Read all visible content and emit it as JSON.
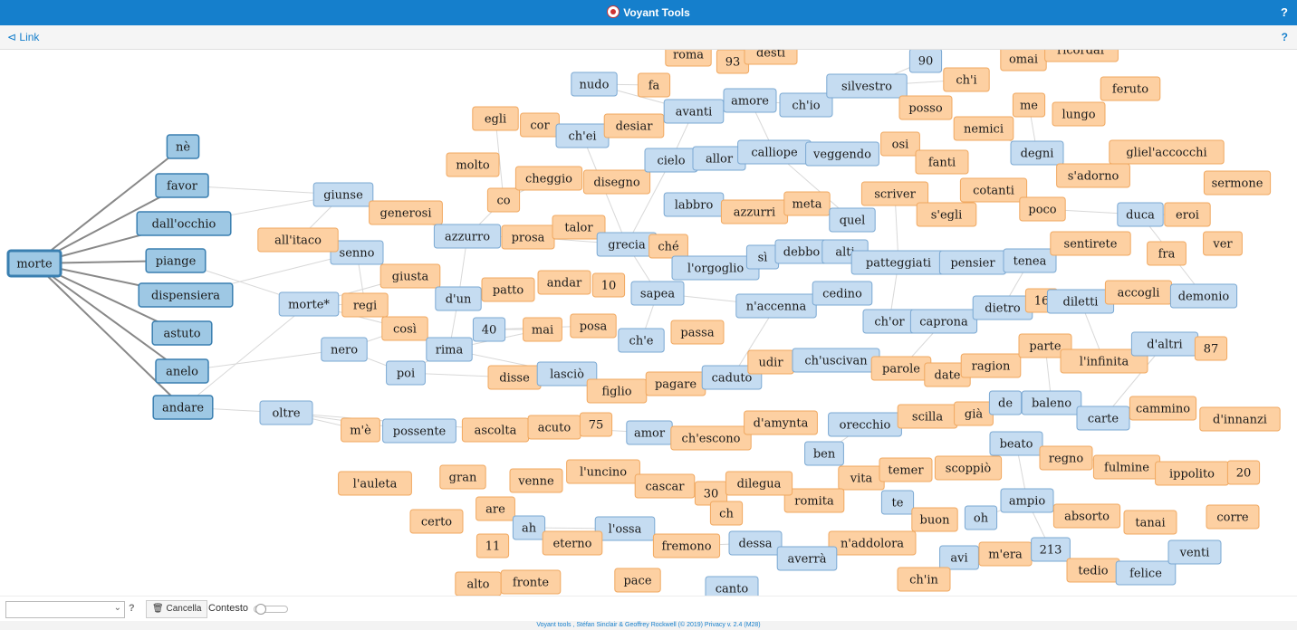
{
  "app": {
    "title": "Voyant Tools",
    "help": "?"
  },
  "toolbar": {
    "link_label": "Link",
    "help": "?"
  },
  "graph": {
    "colors": {
      "corpus_fill": "#9ec8e4",
      "corpus_stroke": "#3a7fb0",
      "blue_fill": "#c5dcf1",
      "blue_stroke": "#7aa8d2",
      "orange_fill": "#fdd0a2",
      "orange_stroke": "#f0a860",
      "edge_main": "#888888",
      "edge_light": "#d8d8d8"
    },
    "nodes": [
      {
        "id": "morte",
        "label": "morte",
        "type": "root"
      },
      {
        "id": "ne",
        "label": "nè",
        "type": "corpus"
      },
      {
        "id": "favor",
        "label": "favor",
        "type": "corpus"
      },
      {
        "id": "dallocchio",
        "label": "dall'occhio",
        "type": "corpus"
      },
      {
        "id": "piange",
        "label": "piange",
        "type": "corpus"
      },
      {
        "id": "dispensiera",
        "label": "dispensiera",
        "type": "corpus"
      },
      {
        "id": "astuto",
        "label": "astuto",
        "type": "corpus"
      },
      {
        "id": "anelo",
        "label": "anelo",
        "type": "corpus"
      },
      {
        "id": "andare",
        "label": "andare",
        "type": "corpus"
      },
      {
        "id": "giunse",
        "label": "giunse",
        "type": "blue"
      },
      {
        "id": "senno",
        "label": "senno",
        "type": "blue"
      },
      {
        "id": "morte2",
        "label": "morte*",
        "type": "blue"
      },
      {
        "id": "nero",
        "label": "nero",
        "type": "blue"
      },
      {
        "id": "oltre",
        "label": "oltre",
        "type": "blue"
      },
      {
        "id": "allitaco",
        "label": "all'itaco",
        "type": "orange"
      },
      {
        "id": "generosi",
        "label": "generosi",
        "type": "orange"
      },
      {
        "id": "giusta",
        "label": "giusta",
        "type": "orange"
      },
      {
        "id": "regi",
        "label": "regi",
        "type": "orange"
      },
      {
        "id": "cosi",
        "label": "così",
        "type": "orange"
      },
      {
        "id": "poi",
        "label": "poi",
        "type": "blue"
      },
      {
        "id": "rima",
        "label": "rima",
        "type": "blue"
      },
      {
        "id": "dun",
        "label": "d'un",
        "type": "blue"
      },
      {
        "id": "n40",
        "label": "40",
        "type": "blue"
      },
      {
        "id": "azzurro",
        "label": "azzurro",
        "type": "blue"
      },
      {
        "id": "molto",
        "label": "molto",
        "type": "orange"
      },
      {
        "id": "co",
        "label": "co",
        "type": "orange"
      },
      {
        "id": "egli",
        "label": "egli",
        "type": "orange"
      },
      {
        "id": "cor",
        "label": "cor",
        "type": "orange"
      },
      {
        "id": "chei",
        "label": "ch'ei",
        "type": "blue"
      },
      {
        "id": "cheggio",
        "label": "cheggio",
        "type": "orange"
      },
      {
        "id": "prosa",
        "label": "prosa",
        "type": "orange"
      },
      {
        "id": "talor",
        "label": "talor",
        "type": "orange"
      },
      {
        "id": "patto",
        "label": "patto",
        "type": "orange"
      },
      {
        "id": "andar",
        "label": "andar",
        "type": "orange"
      },
      {
        "id": "n10",
        "label": "10",
        "type": "orange"
      },
      {
        "id": "mai",
        "label": "mai",
        "type": "orange"
      },
      {
        "id": "posa",
        "label": "posa",
        "type": "orange"
      },
      {
        "id": "disse",
        "label": "disse",
        "type": "orange"
      },
      {
        "id": "lascio",
        "label": "lasciò",
        "type": "blue"
      },
      {
        "id": "figlio",
        "label": "figlio",
        "type": "orange"
      },
      {
        "id": "nudo",
        "label": "nudo",
        "type": "blue"
      },
      {
        "id": "fa",
        "label": "fa",
        "type": "orange"
      },
      {
        "id": "desiar",
        "label": "desiar",
        "type": "orange"
      },
      {
        "id": "disegno",
        "label": "disegno",
        "type": "orange"
      },
      {
        "id": "grecia",
        "label": "grecia",
        "type": "blue"
      },
      {
        "id": "che",
        "label": "ché",
        "type": "orange"
      },
      {
        "id": "sapea",
        "label": "sapea",
        "type": "blue"
      },
      {
        "id": "che2",
        "label": "ch'e",
        "type": "blue"
      },
      {
        "id": "passa",
        "label": "passa",
        "type": "orange"
      },
      {
        "id": "pagare",
        "label": "pagare",
        "type": "orange"
      },
      {
        "id": "caduto",
        "label": "caduto",
        "type": "blue"
      },
      {
        "id": "roma",
        "label": "roma",
        "type": "orange"
      },
      {
        "id": "n93",
        "label": "93",
        "type": "orange"
      },
      {
        "id": "desti",
        "label": "desti",
        "type": "orange"
      },
      {
        "id": "avanti",
        "label": "avanti",
        "type": "blue"
      },
      {
        "id": "amore",
        "label": "amore",
        "type": "blue"
      },
      {
        "id": "chio",
        "label": "ch'io",
        "type": "blue"
      },
      {
        "id": "cielo",
        "label": "cielo",
        "type": "blue"
      },
      {
        "id": "allor",
        "label": "allor",
        "type": "blue"
      },
      {
        "id": "calliope",
        "label": "calliope",
        "type": "blue"
      },
      {
        "id": "veggendo",
        "label": "veggendo",
        "type": "blue"
      },
      {
        "id": "labbro",
        "label": "labbro",
        "type": "blue"
      },
      {
        "id": "azzurri",
        "label": "azzurri",
        "type": "orange"
      },
      {
        "id": "meta",
        "label": "meta",
        "type": "orange"
      },
      {
        "id": "quel",
        "label": "quel",
        "type": "blue"
      },
      {
        "id": "lorgoglio",
        "label": "l'orgoglio",
        "type": "blue"
      },
      {
        "id": "si",
        "label": "sì",
        "type": "blue"
      },
      {
        "id": "debbo",
        "label": "debbo",
        "type": "blue"
      },
      {
        "id": "alti",
        "label": "alti",
        "type": "blue"
      },
      {
        "id": "naccenna",
        "label": "n'accenna",
        "type": "blue"
      },
      {
        "id": "cedino",
        "label": "cedino",
        "type": "blue"
      },
      {
        "id": "udir",
        "label": "udir",
        "type": "orange"
      },
      {
        "id": "chuscivan",
        "label": "ch'uscivan",
        "type": "blue"
      },
      {
        "id": "silvestro",
        "label": "silvestro",
        "type": "blue"
      },
      {
        "id": "n90",
        "label": "90",
        "type": "blue"
      },
      {
        "id": "posso",
        "label": "posso",
        "type": "orange"
      },
      {
        "id": "chi",
        "label": "ch'i",
        "type": "orange"
      },
      {
        "id": "osi",
        "label": "osi",
        "type": "orange"
      },
      {
        "id": "fanti",
        "label": "fanti",
        "type": "orange"
      },
      {
        "id": "scriver",
        "label": "scriver",
        "type": "orange"
      },
      {
        "id": "segli",
        "label": "s'egli",
        "type": "orange"
      },
      {
        "id": "cotanti",
        "label": "cotanti",
        "type": "orange"
      },
      {
        "id": "patteggiati",
        "label": "patteggiati",
        "type": "blue"
      },
      {
        "id": "pensier",
        "label": "pensier",
        "type": "blue"
      },
      {
        "id": "tenea",
        "label": "tenea",
        "type": "blue"
      },
      {
        "id": "chor",
        "label": "ch'or",
        "type": "blue"
      },
      {
        "id": "caprona",
        "label": "caprona",
        "type": "blue"
      },
      {
        "id": "dietro",
        "label": "dietro",
        "type": "blue"
      },
      {
        "id": "parole",
        "label": "parole",
        "type": "orange"
      },
      {
        "id": "date",
        "label": "date",
        "type": "orange"
      },
      {
        "id": "ragion",
        "label": "ragion",
        "type": "orange"
      },
      {
        "id": "orecchio",
        "label": "orecchio",
        "type": "blue"
      },
      {
        "id": "scilla",
        "label": "scilla",
        "type": "orange"
      },
      {
        "id": "gia",
        "label": "già",
        "type": "orange"
      },
      {
        "id": "ben",
        "label": "ben",
        "type": "blue"
      },
      {
        "id": "vita",
        "label": "vita",
        "type": "orange"
      },
      {
        "id": "temer",
        "label": "temer",
        "type": "orange"
      },
      {
        "id": "scoppio",
        "label": "scoppiò",
        "type": "orange"
      },
      {
        "id": "romita",
        "label": "romita",
        "type": "orange"
      },
      {
        "id": "te",
        "label": "te",
        "type": "blue"
      },
      {
        "id": "buon",
        "label": "buon",
        "type": "orange"
      },
      {
        "id": "oh",
        "label": "oh",
        "type": "blue"
      },
      {
        "id": "naddolora",
        "label": "n'addolora",
        "type": "orange"
      },
      {
        "id": "avi",
        "label": "avi",
        "type": "blue"
      },
      {
        "id": "mera",
        "label": "m'era",
        "type": "orange"
      },
      {
        "id": "n213",
        "label": "213",
        "type": "blue"
      },
      {
        "id": "chin",
        "label": "ch'in",
        "type": "orange"
      },
      {
        "id": "omai",
        "label": "omai",
        "type": "orange"
      },
      {
        "id": "ricordar",
        "label": "ricordar",
        "type": "orange"
      },
      {
        "id": "me",
        "label": "me",
        "type": "orange"
      },
      {
        "id": "nemici",
        "label": "nemici",
        "type": "orange"
      },
      {
        "id": "feruto",
        "label": "feruto",
        "type": "orange"
      },
      {
        "id": "lungo",
        "label": "lungo",
        "type": "orange"
      },
      {
        "id": "degni",
        "label": "degni",
        "type": "blue"
      },
      {
        "id": "glielaccocchi",
        "label": "gliel'accocchi",
        "type": "orange"
      },
      {
        "id": "sadorno",
        "label": "s'adorno",
        "type": "orange"
      },
      {
        "id": "sermone",
        "label": "sermone",
        "type": "orange"
      },
      {
        "id": "poco",
        "label": "poco",
        "type": "orange"
      },
      {
        "id": "duca",
        "label": "duca",
        "type": "blue"
      },
      {
        "id": "eroi",
        "label": "eroi",
        "type": "orange"
      },
      {
        "id": "sentirete",
        "label": "sentirete",
        "type": "orange"
      },
      {
        "id": "fra",
        "label": "fra",
        "type": "orange"
      },
      {
        "id": "ver",
        "label": "ver",
        "type": "orange"
      },
      {
        "id": "n16",
        "label": "16",
        "type": "orange"
      },
      {
        "id": "diletti",
        "label": "diletti",
        "type": "blue"
      },
      {
        "id": "accogli",
        "label": "accogli",
        "type": "orange"
      },
      {
        "id": "demonio",
        "label": "demonio",
        "type": "blue"
      },
      {
        "id": "parte",
        "label": "parte",
        "type": "orange"
      },
      {
        "id": "linfinita",
        "label": "l'infinita",
        "type": "orange"
      },
      {
        "id": "daltri",
        "label": "d'altri",
        "type": "blue"
      },
      {
        "id": "n87",
        "label": "87",
        "type": "orange"
      },
      {
        "id": "de",
        "label": "de",
        "type": "blue"
      },
      {
        "id": "baleno",
        "label": "baleno",
        "type": "blue"
      },
      {
        "id": "carte",
        "label": "carte",
        "type": "blue"
      },
      {
        "id": "cammino",
        "label": "cammino",
        "type": "orange"
      },
      {
        "id": "dinnanzi",
        "label": "d'innanzi",
        "type": "orange"
      },
      {
        "id": "beato",
        "label": "beato",
        "type": "blue"
      },
      {
        "id": "regno",
        "label": "regno",
        "type": "orange"
      },
      {
        "id": "fulmine",
        "label": "fulmine",
        "type": "orange"
      },
      {
        "id": "ippolito",
        "label": "ippolito",
        "type": "orange"
      },
      {
        "id": "n20",
        "label": "20",
        "type": "orange"
      },
      {
        "id": "ampio",
        "label": "ampio",
        "type": "blue"
      },
      {
        "id": "absorto",
        "label": "absorto",
        "type": "orange"
      },
      {
        "id": "tanai",
        "label": "tanai",
        "type": "orange"
      },
      {
        "id": "corre",
        "label": "corre",
        "type": "orange"
      },
      {
        "id": "tedio",
        "label": "tedio",
        "type": "orange"
      },
      {
        "id": "felice",
        "label": "felice",
        "type": "blue"
      },
      {
        "id": "venti",
        "label": "venti",
        "type": "blue"
      },
      {
        "id": "mee",
        "label": "m'è",
        "type": "orange"
      },
      {
        "id": "possente",
        "label": "possente",
        "type": "blue"
      },
      {
        "id": "ascolta",
        "label": "ascolta",
        "type": "orange"
      },
      {
        "id": "acuto",
        "label": "acuto",
        "type": "orange"
      },
      {
        "id": "n75",
        "label": "75",
        "type": "orange"
      },
      {
        "id": "amor",
        "label": "amor",
        "type": "blue"
      },
      {
        "id": "chescono",
        "label": "ch'escono",
        "type": "orange"
      },
      {
        "id": "damynta",
        "label": "d'amynta",
        "type": "orange"
      },
      {
        "id": "lauleta",
        "label": "l'auleta",
        "type": "orange"
      },
      {
        "id": "gran",
        "label": "gran",
        "type": "orange"
      },
      {
        "id": "venne",
        "label": "venne",
        "type": "orange"
      },
      {
        "id": "luncino",
        "label": "l'uncino",
        "type": "orange"
      },
      {
        "id": "cascar",
        "label": "cascar",
        "type": "orange"
      },
      {
        "id": "n30",
        "label": "30",
        "type": "orange"
      },
      {
        "id": "dilegua",
        "label": "dilegua",
        "type": "orange"
      },
      {
        "id": "ch",
        "label": "ch",
        "type": "orange"
      },
      {
        "id": "certo",
        "label": "certo",
        "type": "orange"
      },
      {
        "id": "are",
        "label": "are",
        "type": "orange"
      },
      {
        "id": "ah",
        "label": "ah",
        "type": "blue"
      },
      {
        "id": "lossa",
        "label": "l'ossa",
        "type": "blue"
      },
      {
        "id": "eterno",
        "label": "eterno",
        "type": "orange"
      },
      {
        "id": "fremono",
        "label": "fremono",
        "type": "orange"
      },
      {
        "id": "dessa",
        "label": "dessa",
        "type": "blue"
      },
      {
        "id": "averra",
        "label": "averrà",
        "type": "blue"
      },
      {
        "id": "n11",
        "label": "11",
        "type": "orange"
      },
      {
        "id": "alto",
        "label": "alto",
        "type": "orange"
      },
      {
        "id": "fronte",
        "label": "fronte",
        "type": "orange"
      },
      {
        "id": "pace",
        "label": "pace",
        "type": "orange"
      },
      {
        "id": "canto",
        "label": "canto",
        "type": "blue"
      }
    ]
  },
  "bottom": {
    "clear_label": "Cancella",
    "context_label": "Contesto",
    "help": "?"
  },
  "footer": {
    "text": "Voyant tools , Stéfan Sinclair & Geoffrey Rockwell (© 2019) Privacy v. 2.4 (M28)"
  }
}
